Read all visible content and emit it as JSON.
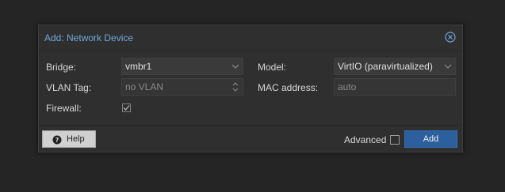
{
  "dialog": {
    "title": "Add: Network Device",
    "close_icon": "close-circle-icon"
  },
  "form": {
    "bridge_label": "Bridge:",
    "bridge_value": "vmbr1",
    "vlan_label": "VLAN Tag:",
    "vlan_placeholder": "no VLAN",
    "firewall_label": "Firewall:",
    "firewall_checked": true,
    "model_label": "Model:",
    "model_value": "VirtIO (paravirtualized)",
    "mac_label": "MAC address:",
    "mac_placeholder": "auto"
  },
  "footer": {
    "help_label": "Help",
    "help_icon": "question-circle-icon",
    "advanced_label": "Advanced",
    "advanced_checked": false,
    "add_label": "Add"
  },
  "colors": {
    "title": "#6fa8dc",
    "primary_button": "#2b5f9e",
    "background": "#252525",
    "dialog": "#2f2f2f"
  }
}
